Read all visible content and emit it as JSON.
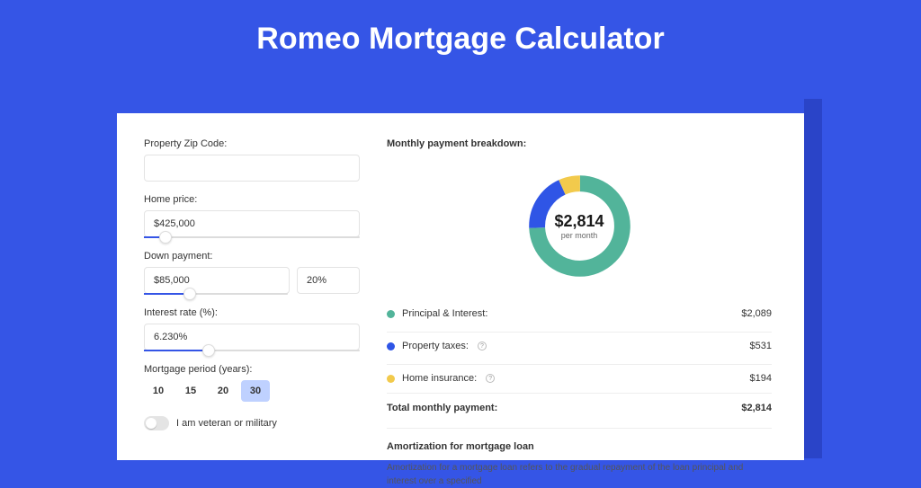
{
  "title": "Romeo Mortgage Calculator",
  "form": {
    "zip_label": "Property Zip Code:",
    "zip_value": "",
    "home_price_label": "Home price:",
    "home_price_value": "$425,000",
    "home_price_slider_pct": 10,
    "down_label": "Down payment:",
    "down_value": "$85,000",
    "down_pct_value": "20%",
    "down_slider_pct": 20,
    "rate_label": "Interest rate (%):",
    "rate_value": "6.230%",
    "rate_slider_pct": 30,
    "period_label": "Mortgage period (years):",
    "periods": [
      "10",
      "15",
      "20",
      "30"
    ],
    "period_selected": "30",
    "veteran_label": "I am veteran or military"
  },
  "breakdown": {
    "heading": "Monthly payment breakdown:",
    "center_amount": "$2,814",
    "center_sub": "per month",
    "items": [
      {
        "label": "Principal & Interest:",
        "value": "$2,089"
      },
      {
        "label": "Property taxes:",
        "value": "$531"
      },
      {
        "label": "Home insurance:",
        "value": "$194"
      }
    ],
    "total_label": "Total monthly payment:",
    "total_value": "$2,814"
  },
  "amortization": {
    "heading": "Amortization for mortgage loan",
    "text": "Amortization for a mortgage loan refers to the gradual repayment of the loan principal and interest over a specified"
  },
  "chart_data": {
    "type": "pie",
    "title": "Monthly payment breakdown",
    "series": [
      {
        "name": "Principal & Interest",
        "value": 2089,
        "color": "#52b49a"
      },
      {
        "name": "Property taxes",
        "value": 531,
        "color": "#2f55e6"
      },
      {
        "name": "Home insurance",
        "value": 194,
        "color": "#f2ca4c"
      }
    ],
    "total": 2814
  }
}
